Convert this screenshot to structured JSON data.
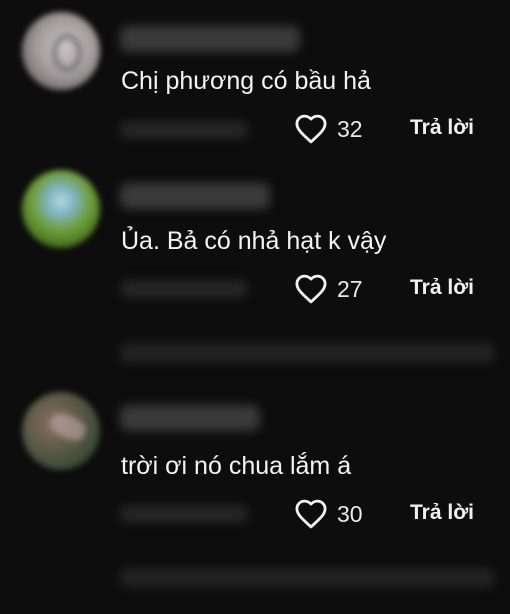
{
  "comments": [
    {
      "text": "Chị phương có bầu hả",
      "likes": "32",
      "reply_label": "Trả lời",
      "like_icon": "heart-outline-icon"
    },
    {
      "text": "Ủa. Bả có nhả hạt k vậy",
      "likes": "27",
      "reply_label": "Trả lời",
      "like_icon": "heart-outline-icon"
    },
    {
      "text": "trời ơi nó chua lắm á",
      "likes": "30",
      "reply_label": "Trả lời",
      "like_icon": "heart-outline-icon"
    }
  ]
}
